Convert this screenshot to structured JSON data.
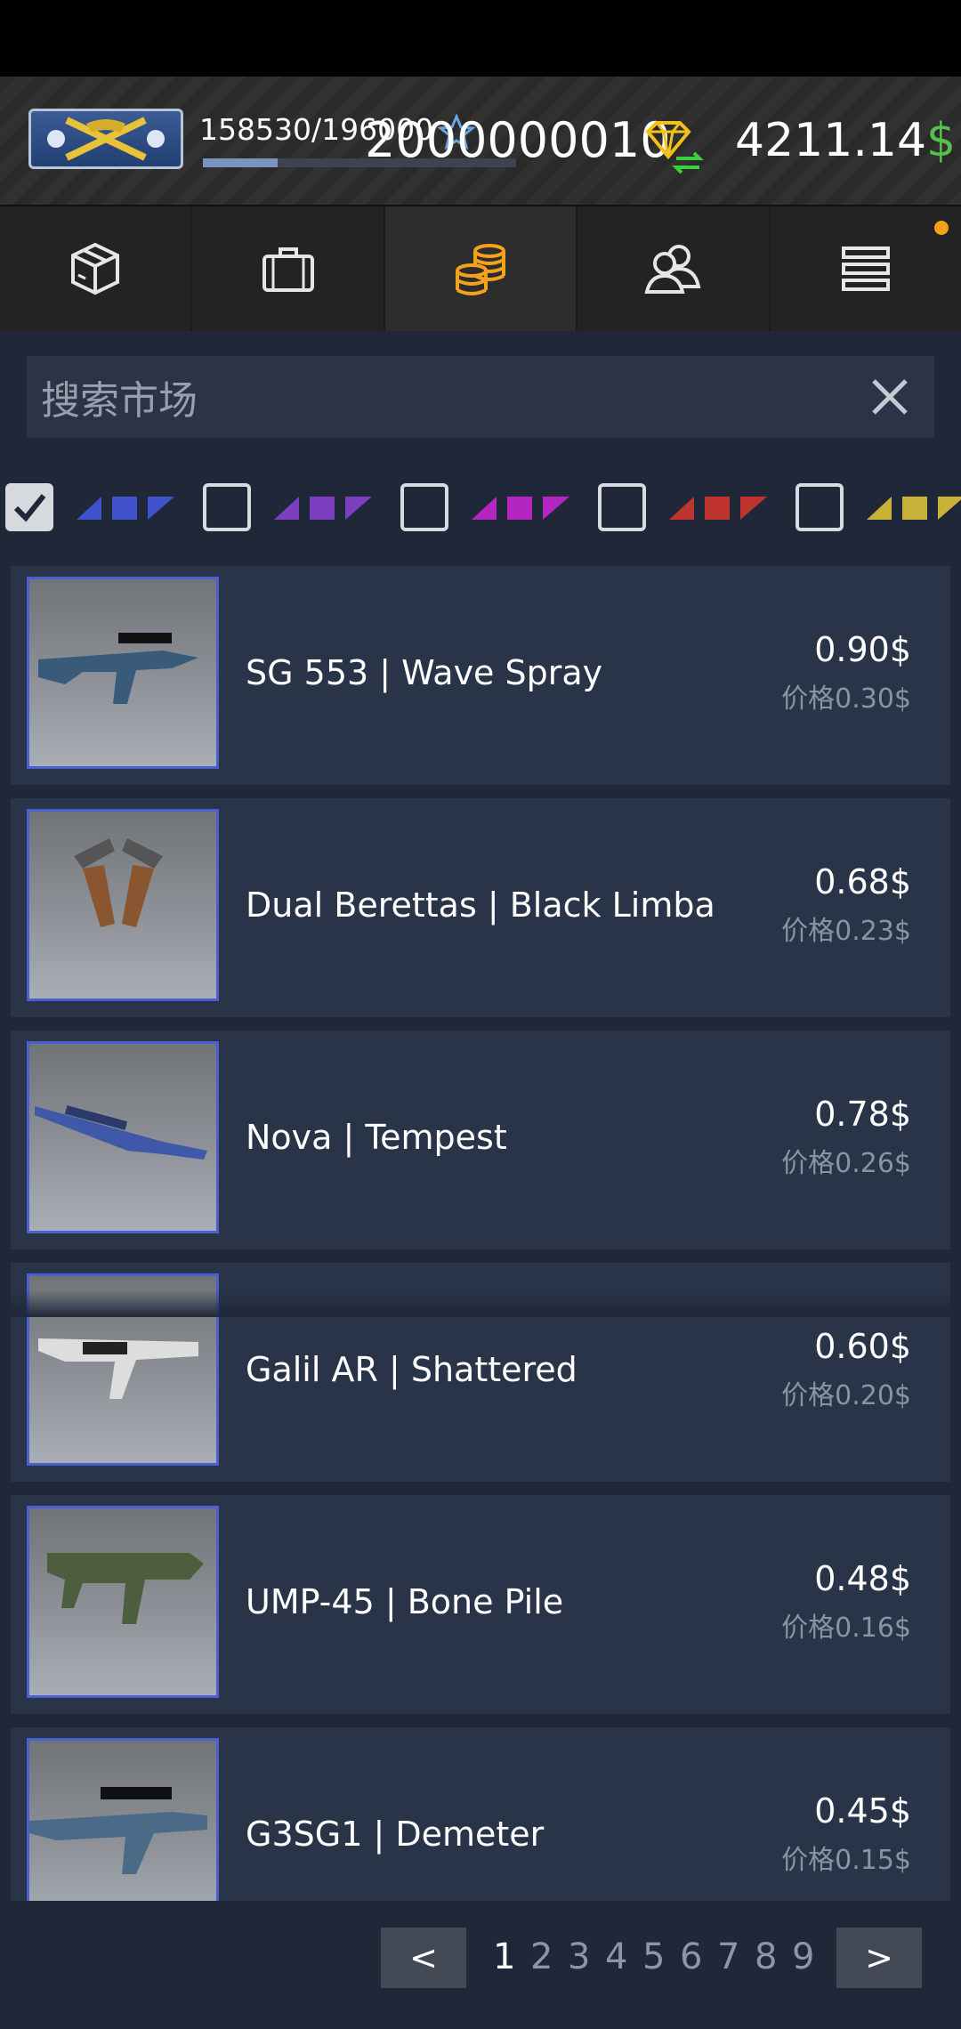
{
  "header": {
    "xp_text": "158530/196000",
    "xp_progress": 0.24,
    "gems": "2000000010",
    "money_amount": "4211.14",
    "money_currency": "$",
    "colors": {
      "money_currency": "#55c04c",
      "gem": "#f2c21b"
    },
    "icons": {
      "rank": "rank-badge-icon",
      "gem": "diamond-exchange-icon",
      "xp": "star-outline-icon"
    }
  },
  "nav": {
    "tabs": [
      {
        "icon": "box-icon"
      },
      {
        "icon": "briefcase-icon"
      },
      {
        "icon": "coins-icon",
        "active": true
      },
      {
        "icon": "users-icon"
      },
      {
        "icon": "menu-icon",
        "notification": true
      }
    ]
  },
  "search": {
    "placeholder": "搜索市场"
  },
  "filters": [
    {
      "checked": true,
      "color": "#3f52cc"
    },
    {
      "checked": false,
      "color": "#7c3fc0"
    },
    {
      "checked": false,
      "color": "#b526c0"
    },
    {
      "checked": false,
      "color": "#c0342f"
    },
    {
      "checked": false,
      "color": "#c9b23a"
    }
  ],
  "items": [
    {
      "name": "SG 553 | Wave Spray",
      "price": "0.90$",
      "orig_price": "价格0.30$"
    },
    {
      "name": "Dual Berettas | Black Limba",
      "price": "0.68$",
      "orig_price": "价格0.23$"
    },
    {
      "name": "Nova | Tempest",
      "price": "0.78$",
      "orig_price": "价格0.26$"
    },
    {
      "name": "Galil AR | Shattered",
      "price": "0.60$",
      "orig_price": "价格0.20$"
    },
    {
      "name": "UMP-45 | Bone Pile",
      "price": "0.48$",
      "orig_price": "价格0.16$"
    },
    {
      "name": "G3SG1 | Demeter",
      "price": "0.45$",
      "orig_price": "价格0.15$"
    }
  ],
  "pagination": {
    "prev_label": "<",
    "next_label": ">",
    "pages": [
      "1",
      "2",
      "3",
      "4",
      "5",
      "6",
      "7",
      "8",
      "9"
    ],
    "current_page": "1"
  }
}
